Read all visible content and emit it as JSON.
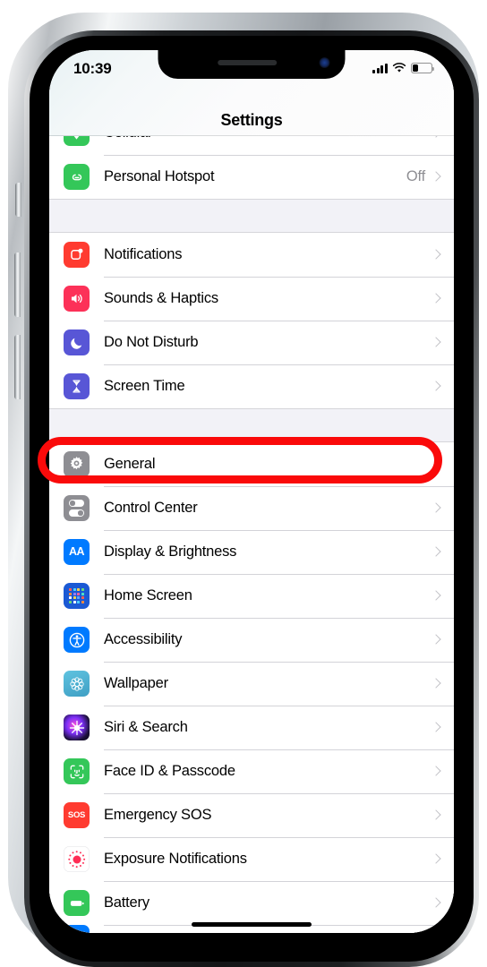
{
  "device": {
    "name": "iphone-x-silver"
  },
  "status_bar": {
    "time": "10:39",
    "signal_icon": "cellular-bars-icon",
    "wifi_icon": "wifi-icon",
    "battery_icon": "battery-icon",
    "battery_level_percent": 25
  },
  "header": {
    "title": "Settings"
  },
  "annotation": {
    "type": "red-ellipse-highlight",
    "target": "General",
    "color": "#FA0A0A"
  },
  "groups": [
    {
      "name": "connectivity",
      "rows": [
        {
          "label": "Cellular",
          "icon": "cellular-icon",
          "icon_color": "#34C759",
          "value": "",
          "partial_top": true
        },
        {
          "label": "Personal Hotspot",
          "icon": "personal-hotspot-icon",
          "icon_color": "#34C759",
          "value": "Off"
        }
      ]
    },
    {
      "name": "alerts",
      "rows": [
        {
          "label": "Notifications",
          "icon": "notifications-icon",
          "icon_color": "#FF3B30",
          "value": ""
        },
        {
          "label": "Sounds & Haptics",
          "icon": "sounds-haptics-icon",
          "icon_color": "#FC3158",
          "value": ""
        },
        {
          "label": "Do Not Disturb",
          "icon": "do-not-disturb-icon",
          "icon_color": "#5856D6",
          "value": ""
        },
        {
          "label": "Screen Time",
          "icon": "screen-time-icon",
          "icon_color": "#5856D6",
          "value": ""
        }
      ]
    },
    {
      "name": "system",
      "rows": [
        {
          "label": "General",
          "icon": "gear-icon",
          "icon_color": "#8E8E93",
          "value": "",
          "highlighted": true
        },
        {
          "label": "Control Center",
          "icon": "control-center-icon",
          "icon_color": "#8E8E93",
          "value": ""
        },
        {
          "label": "Display & Brightness",
          "icon": "display-brightness-icon",
          "icon_color": "#007AFF",
          "value": ""
        },
        {
          "label": "Home Screen",
          "icon": "home-screen-icon",
          "icon_color": "#1B59D4",
          "value": ""
        },
        {
          "label": "Accessibility",
          "icon": "accessibility-icon",
          "icon_color": "#007AFF",
          "value": ""
        },
        {
          "label": "Wallpaper",
          "icon": "wallpaper-icon",
          "icon_color": "#4FB5D0",
          "value": ""
        },
        {
          "label": "Siri & Search",
          "icon": "siri-search-icon",
          "icon_color": "#7B2FF7",
          "value": ""
        },
        {
          "label": "Face ID & Passcode",
          "icon": "face-id-icon",
          "icon_color": "#34C759",
          "value": ""
        },
        {
          "label": "Emergency SOS",
          "icon": "emergency-sos-icon",
          "icon_color": "#FF3B30",
          "value": ""
        },
        {
          "label": "Exposure Notifications",
          "icon": "exposure-notifications-icon",
          "icon_color": "#FF2D55",
          "value": ""
        },
        {
          "label": "Battery",
          "icon": "battery-settings-icon",
          "icon_color": "#34C759",
          "value": ""
        }
      ]
    }
  ]
}
